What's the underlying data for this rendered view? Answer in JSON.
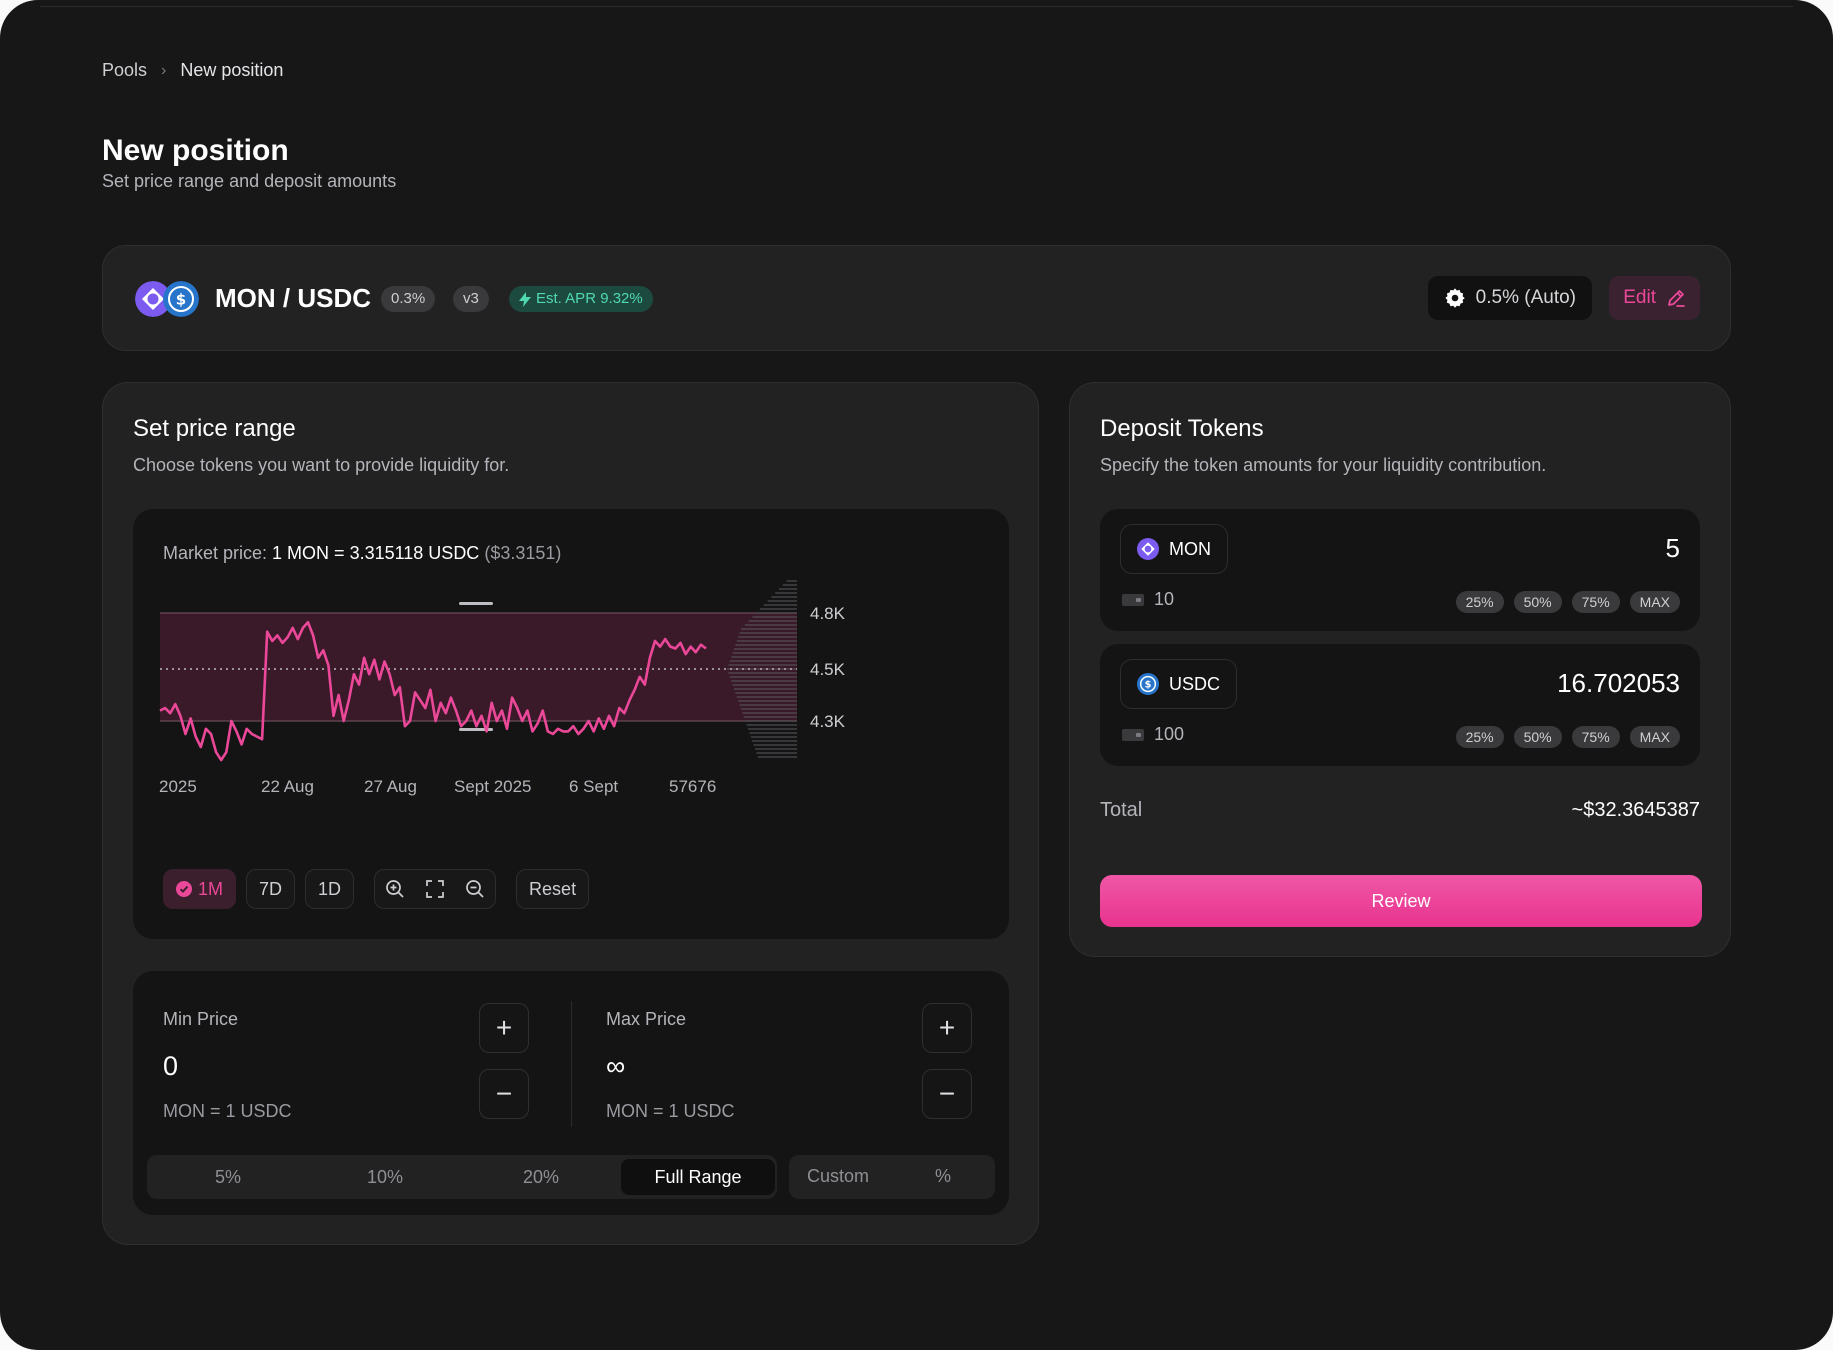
{
  "breadcrumb": {
    "root": "Pools",
    "current": "New position"
  },
  "header": {
    "title": "New position",
    "subtitle": "Set price range and deposit amounts"
  },
  "pair": {
    "name": "MON / USDC",
    "fee": "0.3%",
    "version": "v3",
    "apr": "Est. APR 9.32%",
    "slippage": "0.5% (Auto)",
    "edit_label": "Edit",
    "token_a_color": "#8b5cf6",
    "token_b_color": "#2775ca"
  },
  "price_range": {
    "title": "Set price range",
    "subtitle": "Choose tokens you want to provide liquidity for.",
    "market_label": "Market price:",
    "market_value": "1 MON = 3.315118 USDC",
    "market_usd": "($3.3151)",
    "controls": {
      "active": "1M",
      "seven_day": "7D",
      "one_day": "1D",
      "reset": "Reset"
    }
  },
  "chart_data": {
    "type": "line",
    "x_ticks": [
      "2025",
      "22 Aug",
      "27 Aug",
      "Sept 2025",
      "6 Sept",
      "57676"
    ],
    "y_ticks": [
      "4.8K",
      "4.5K",
      "4.3K"
    ],
    "ylim": [
      4150,
      4900
    ],
    "series": [
      {
        "color": "#ec4899",
        "values": [
          4340,
          4350,
          4330,
          4365,
          4320,
          4250,
          4310,
          4240,
          4200,
          4270,
          4250,
          4180,
          4150,
          4180,
          4300,
          4260,
          4210,
          4270,
          4250,
          4240,
          4230,
          4700,
          4650,
          4680,
          4640,
          4670,
          4720,
          4660,
          4720,
          4750,
          4680,
          4560,
          4600,
          4520,
          4320,
          4400,
          4300,
          4380,
          4480,
          4440,
          4560,
          4480,
          4550,
          4460,
          4540,
          4480,
          4400,
          4430,
          4280,
          4300,
          4410,
          4380,
          4350,
          4420,
          4300,
          4370,
          4330,
          4390,
          4340,
          4280,
          4300,
          4340,
          4280,
          4320,
          4260,
          4370,
          4300,
          4340,
          4270,
          4390,
          4350,
          4300,
          4340,
          4260,
          4290,
          4340,
          4260,
          4250,
          4270,
          4260,
          4260,
          4280,
          4250,
          4270,
          4300,
          4260,
          4310,
          4270,
          4320,
          4280,
          4350,
          4330,
          4380,
          4420,
          4470,
          4440,
          4560,
          4650,
          4620,
          4660,
          4620,
          4610,
          4640,
          4580,
          4620,
          4590,
          4630,
          4610
        ]
      }
    ],
    "range_band": {
      "min": 4320,
      "max": 4800
    },
    "current_price_line": 4500,
    "grid": false
  },
  "range": {
    "min_label": "Min Price",
    "min_value": "0",
    "max_label": "Max Price",
    "max_value": "∞",
    "unit": "MON = 1 USDC",
    "presets": [
      "5%",
      "10%",
      "20%",
      "Full Range"
    ],
    "active_preset": "Full Range",
    "custom_label": "Custom",
    "custom_suffix": "%"
  },
  "deposit": {
    "title": "Deposit Tokens",
    "subtitle": "Specify the token amounts for your liquidity contribution.",
    "tokens": [
      {
        "symbol": "MON",
        "amount": "5",
        "balance": "10"
      },
      {
        "symbol": "USDC",
        "amount": "16.702053",
        "balance": "100"
      }
    ],
    "percent_buttons": [
      "25%",
      "50%",
      "75%",
      "MAX"
    ],
    "total_label": "Total",
    "total_value": "~$32.3645387",
    "review_label": "Review"
  }
}
